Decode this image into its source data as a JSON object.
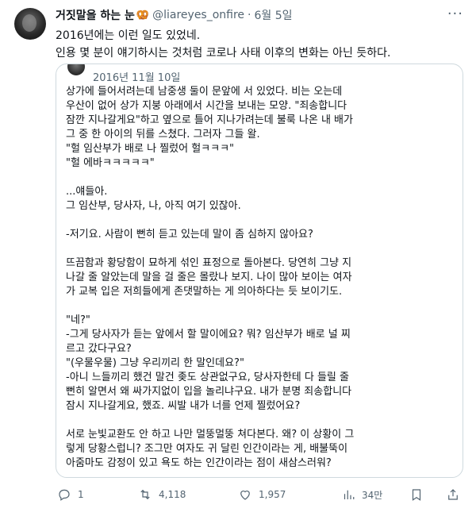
{
  "author": {
    "name": "거짓말을 하는 눈",
    "emoji": "🥨",
    "handle": "@liareyes_onfire",
    "separator": "·",
    "date": "6월 5일"
  },
  "more_icon": "···",
  "tweet": {
    "lines": [
      "2016년에는 이런 일도 있었네.",
      "인용 몇 분이 얘기하시는 것처럼 코로나 사태 이후의 변화는 아닌 듯하다."
    ]
  },
  "quote": {
    "date": "2016년 11월 10일",
    "lines": [
      "상가에 들어서려는데 남중생 둘이 문앞에 서 있었다. 비는 오는데",
      "우산이 없어 상가 지붕 아래에서 시간을 보내는 모양. \"죄송합니다",
      "잠깐 지나갈게요\"하고 옆으로 틀어 지나가려는데 불룩 나온 내 배가",
      "그 중 한 아이의 뒤를 스쳤다. 그러자 그들 왈.",
      "\"헐 임산부가 배로 나 찔렀어 헐ㅋㅋㅋ\"",
      "\"헐 에바ㅋㅋㅋㅋㅋ\"",
      "",
      "...얘들아.",
      "그 임산부, 당사자, 나, 아직 여기 있잖아.",
      "",
      "-저기요. 사람이 뻔히 듣고 있는데 말이 좀 심하지 않아요?",
      "",
      "뜨끔함과 황당함이 묘하게 섞인 표정으로 돌아본다. 당연히 그냥 지",
      "나갈 줄 알았는데 말을 걸 줄은 몰랐나 보지. 나이 많아 보이는 여자",
      "가 교복 입은 저희들에게 존댓말하는 게 의아하다는 듯 보이기도.",
      "",
      "\"네?\"",
      "-그게 당사자가 듣는 앞에서 할 말이에요? 뭐? 임산부가 배로 널 찌",
      "르고 갔다구요?",
      "\"(우물우물) 그냥 우리끼리 한 말인데요?\"",
      "-아니 느들끼리 했건 말건 좆도 상관없구요, 당사자한테 다 들릴 줄",
      "뻔히 알면서 왜 싸가지없이 입을 놀리냐구요. 내가 분명 죄송합니다",
      "잠시 지나갈게요, 했죠. 씨발 내가 너를 언제 찔렀어요?",
      "",
      "서로 눈빛교환도 안 하고 나만 멀뚱멀뚱 쳐다본다. 왜? 이 상황이 그",
      "렇게 당황스럽니? 조그만 여자도 귀 달린 인간이라는 게, 배불뚝이",
      "아줌마도 감정이 있고 욕도 하는 인간이라는 점이 새삼스러워?"
    ]
  },
  "actions": {
    "reply_count": "1",
    "retweet_count": "4,118",
    "like_count": "1,957",
    "views_count": "34만"
  }
}
